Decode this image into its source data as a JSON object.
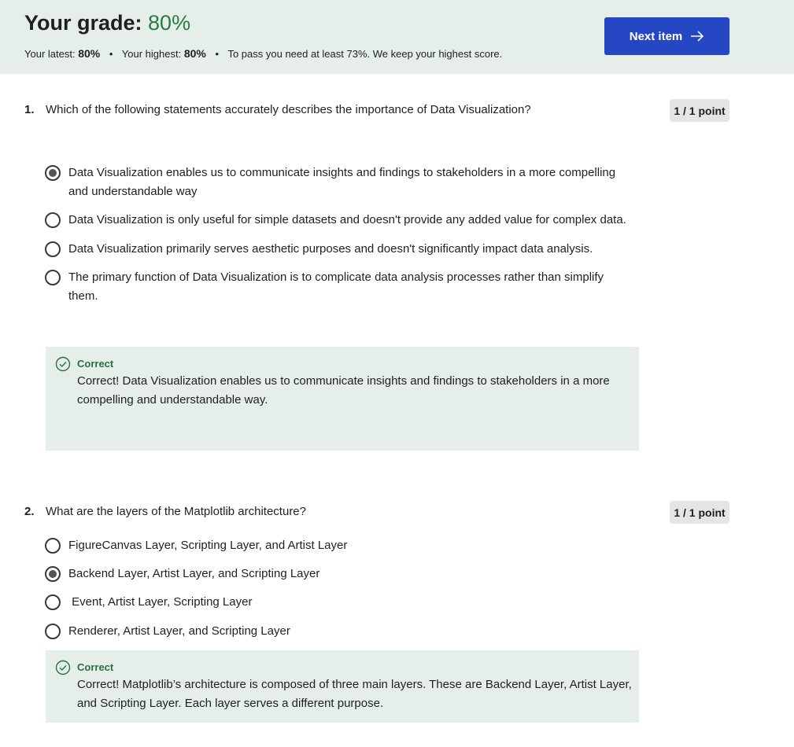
{
  "header": {
    "grade_label": "Your grade:",
    "grade_value": "80%",
    "latest_label": "Your latest:",
    "latest_value": "80%",
    "highest_label": "Your highest:",
    "highest_value": "80%",
    "pass_note": "To pass you need at least 73%. We keep your highest score.",
    "separator": "•",
    "next_button": "Next item",
    "next_icon": "arrow-right-icon"
  },
  "questions": [
    {
      "number": "1.",
      "text": "Which of the following statements accurately describes the importance of Data Visualization?",
      "points": "1 / 1 point",
      "options": [
        {
          "text": "Data Visualization enables us to communicate insights and findings to stakeholders in a more compelling and understandable way",
          "selected": true
        },
        {
          "text": "Data Visualization is only useful for simple datasets and doesn't provide any added value for complex data.",
          "selected": false
        },
        {
          "text": "Data Visualization primarily serves aesthetic purposes and doesn't significantly impact data analysis.",
          "selected": false
        },
        {
          "text": "The primary function of Data Visualization is to complicate data analysis processes rather than simplify them.",
          "selected": false
        }
      ],
      "feedback_label": "Correct",
      "feedback_text": "Correct!  Data Visualization enables us to communicate insights and findings to stakeholders in a more compelling and understandable way."
    },
    {
      "number": "2.",
      "text": "What are the layers of the Matplotlib architecture?",
      "points": "1 / 1 point",
      "options": [
        {
          "text": "FigureCanvas Layer, Scripting Layer, and Artist Layer",
          "selected": false
        },
        {
          "text": "Backend Layer, Artist Layer, and Scripting Layer",
          "selected": true
        },
        {
          "text": " Event, Artist Layer, Scripting Layer",
          "selected": false
        },
        {
          "text": "Renderer, Artist Layer, and Scripting Layer",
          "selected": false
        }
      ],
      "feedback_label": "Correct",
      "feedback_text": "Correct! Matplotlib’s architecture is composed of three main layers. These are Backend Layer, Artist Layer, and Scripting Layer. Each layer serves a different purpose."
    }
  ],
  "colors": {
    "header_bg": "#e6eeea",
    "accent_button": "#2547c4",
    "grade_green": "#2a7a45",
    "correct_green": "#2a6e42"
  }
}
